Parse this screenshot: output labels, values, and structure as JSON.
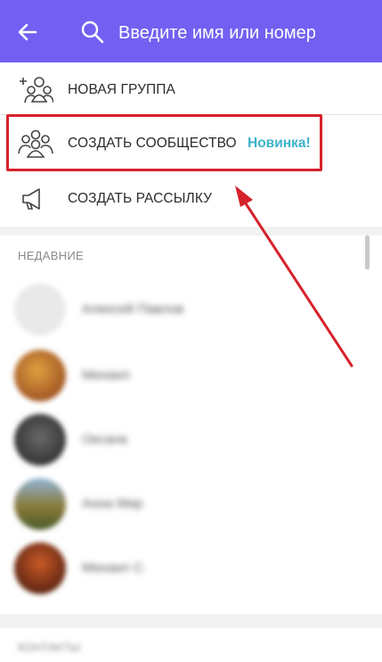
{
  "header": {
    "search_placeholder": "Введите имя или номер",
    "background_color": "#7360f2",
    "back_icon": "arrow-left-icon",
    "search_icon": "search-icon"
  },
  "menu": {
    "new_group_label": "НОВАЯ ГРУППА",
    "create_community_label": "СОЗДАТЬ СООБЩЕСТВО",
    "new_badge": "Новинка!",
    "create_broadcast_label": "СОЗДАТЬ РАССЫЛКУ",
    "badge_color": "#3cb3c9",
    "highlight_color": "#d6212b"
  },
  "recent": {
    "title": "НЕДАВНИЕ",
    "contacts": [
      {
        "name": "Алексей Павлов",
        "avatar_color": "#e9e9e9"
      },
      {
        "name": "Михаил",
        "avatar_color": "#b46a2a"
      },
      {
        "name": "Оксана",
        "avatar_color": "#3e3e3e"
      },
      {
        "name": "Анна Мир",
        "avatar_color": "#6e8a56"
      },
      {
        "name": "Михаил С.",
        "avatar_color": "#7a3218"
      }
    ]
  },
  "footer": {
    "next_section_title": "КОНТАКТЫ"
  }
}
